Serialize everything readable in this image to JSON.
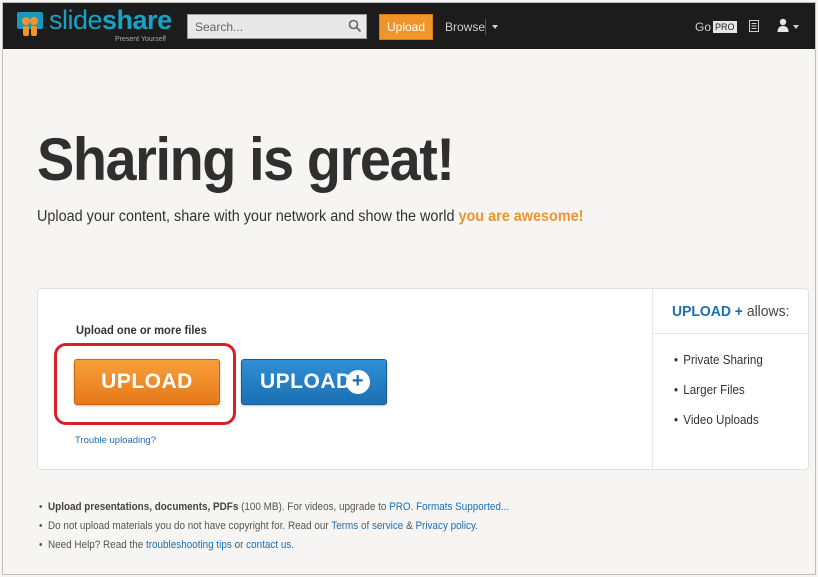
{
  "topbar": {
    "logo": {
      "name": "slideshare",
      "part1": "slide",
      "part2": "share",
      "tagline": "Present Yourself"
    },
    "search": {
      "placeholder": "Search..."
    },
    "upload_label": "Upload",
    "browse_label": "Browse",
    "go_label": "Go",
    "pro_label": "PRO"
  },
  "hero": {
    "title": "Sharing is great!",
    "subtitle": "Upload your content, share with your network and show the world",
    "subtitle_accent": "you are awesome!"
  },
  "upload_card": {
    "label": "Upload one or more files",
    "upload_button": "UPLOAD",
    "upload_plus_button": "UPLOAD",
    "plus_symbol": "+",
    "trouble_link": "Trouble uploading?",
    "allows": {
      "title_prefix": "UPLOAD",
      "title_plus": "+",
      "title_suffix": "allows:",
      "items": [
        "Private Sharing",
        "Larger Files",
        "Video Uploads"
      ]
    }
  },
  "notes": {
    "line1": {
      "bold": "Upload presentations, documents, PDFs",
      "text": "(100 MB). For videos, upgrade to",
      "link_pro": "PRO",
      "sep": ".",
      "link_formats": "Formats Supported..."
    },
    "line2": {
      "text": "Do not upload materials you do not have copyright for. Read our",
      "link_terms": "Terms of service",
      "amp": "&",
      "link_privacy": "Privacy policy",
      "end": "."
    },
    "line3": {
      "text": "Need Help? Read the",
      "link_tips": "troubleshooting tips",
      "or": "or",
      "link_contact": "contact us",
      "end": "."
    }
  },
  "colors": {
    "accent_orange": "#f0952a",
    "accent_blue": "#1c6fb2",
    "highlight_red": "#d8202a",
    "brand_teal": "#18a3c4"
  },
  "icons": [
    "slideshare-logo-icon",
    "search-icon",
    "caret-down-icon",
    "document-icon",
    "user-icon",
    "plus-icon"
  ]
}
